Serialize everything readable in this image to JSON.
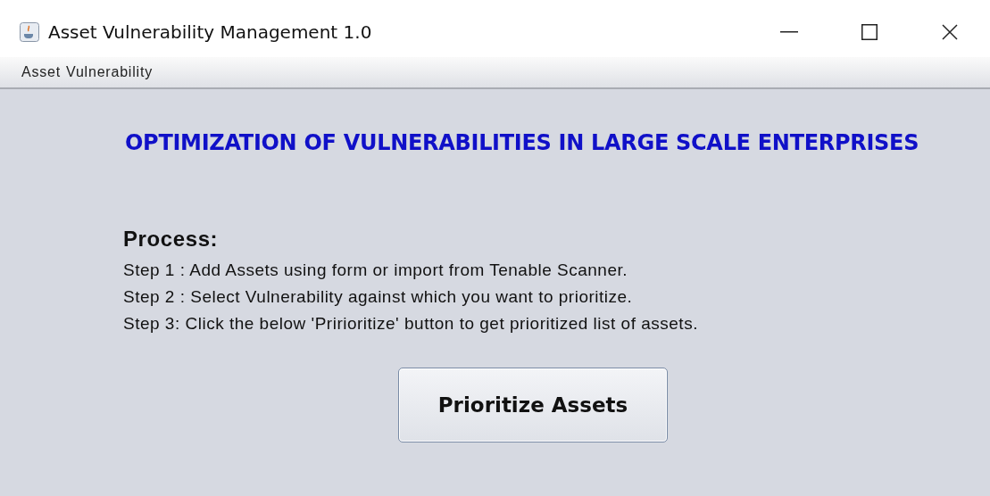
{
  "window": {
    "title": "Asset Vulnerability Management 1.0"
  },
  "menu": [
    "Asset",
    "Vulnerability"
  ],
  "heading": "OPTIMIZATION OF VULNERABILITIES IN LARGE SCALE ENTERPRISES",
  "process": {
    "title": "Process:",
    "steps": [
      "Step 1 : Add Assets using form or import from Tenable Scanner.",
      "Step 2 : Select Vulnerability against which you want to prioritize.",
      "Step 3: Click the below 'Pririoritize' button to get prioritized list of assets."
    ]
  },
  "button": "Prioritize Assets"
}
